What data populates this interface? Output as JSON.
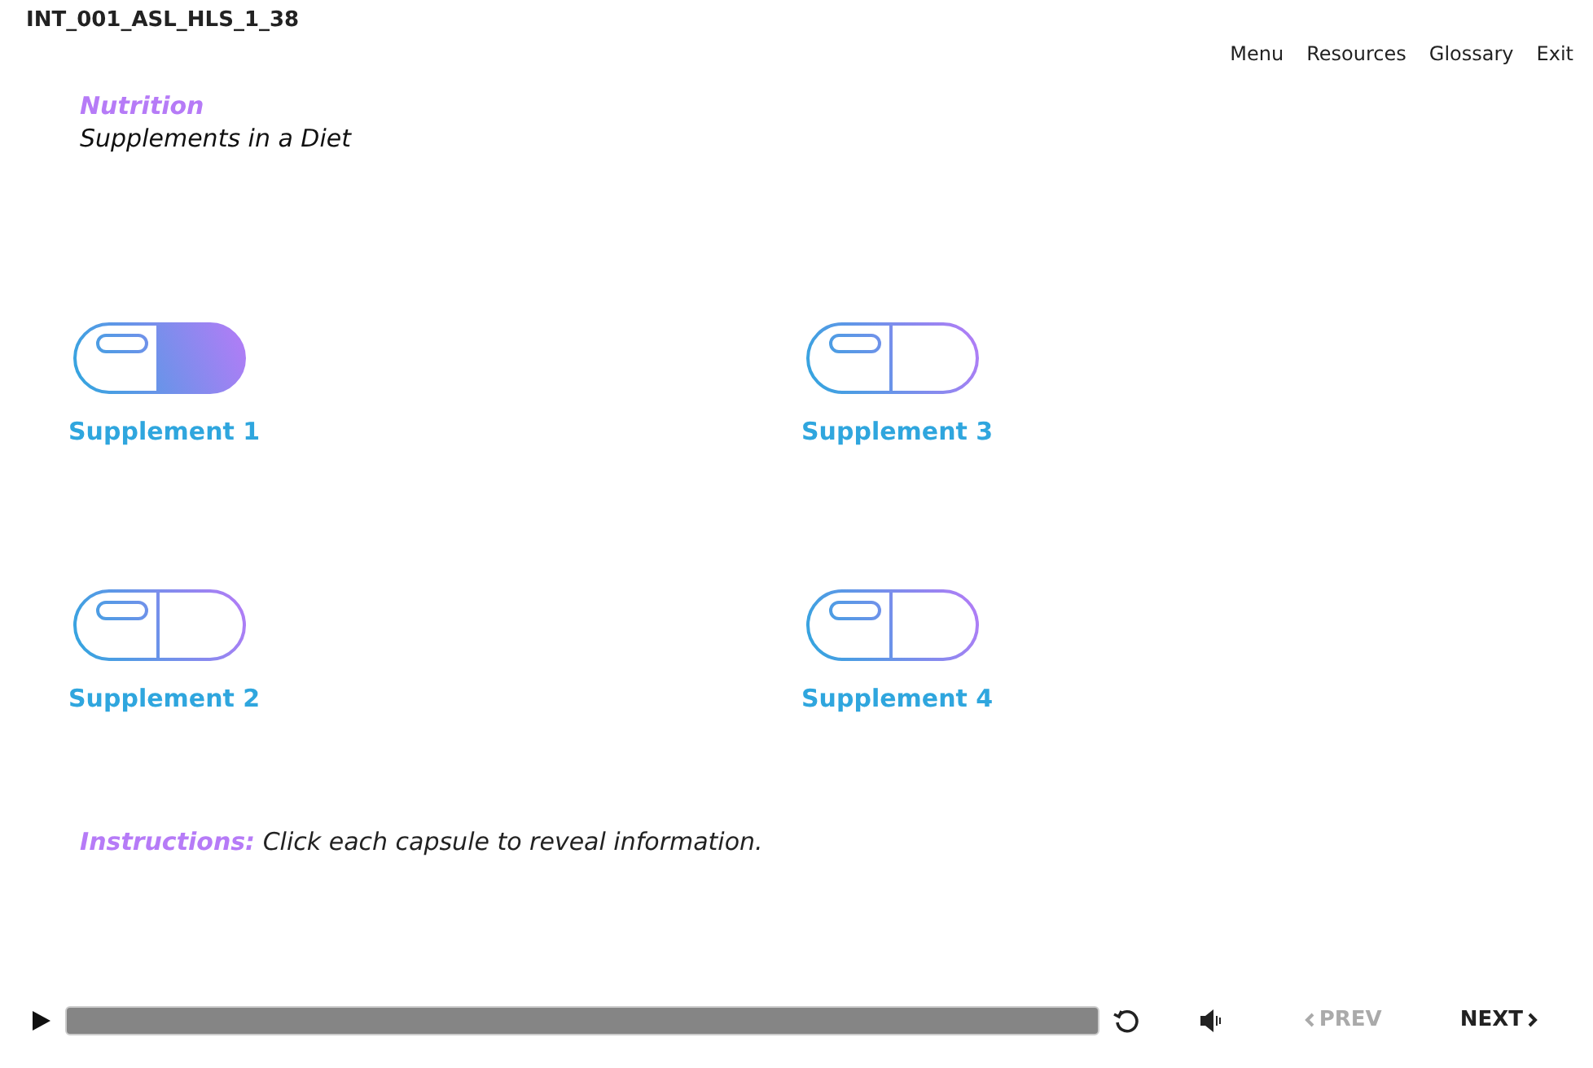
{
  "header": {
    "title": "INT_001_ASL_HLS_1_38"
  },
  "nav": [
    "Menu",
    "Resources",
    "Glossary",
    "Exit"
  ],
  "topic": {
    "title": "Nutrition",
    "subtitle": "Supplements in a Diet"
  },
  "capsules": [
    {
      "label": "Supplement 1",
      "visited": true
    },
    {
      "label": "Supplement 3",
      "visited": false
    },
    {
      "label": "Supplement 2",
      "visited": false
    },
    {
      "label": "Supplement 4",
      "visited": false
    }
  ],
  "instructions": "**Instructions:** Click each capsule to reveal information.",
  "player": {
    "prev": {
      "label": "PREV",
      "disabled": true
    },
    "next": {
      "label": "NEXT",
      "disabled": false
    }
  }
}
